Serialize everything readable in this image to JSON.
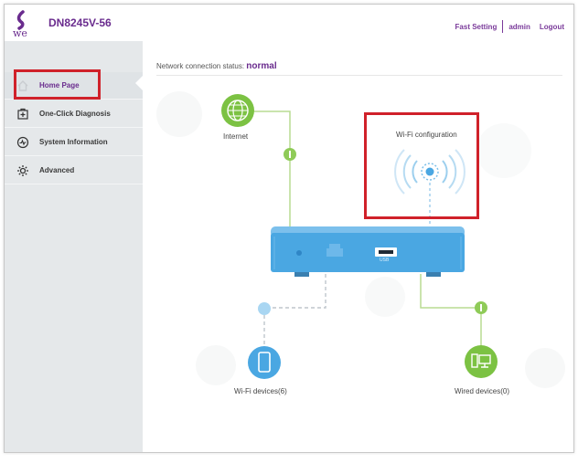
{
  "header": {
    "model": "DN8245V-56",
    "logo_text": "we",
    "links": [
      "Fast Setting",
      "admin",
      "Logout"
    ]
  },
  "sidebar": {
    "items": [
      {
        "label": "Home Page",
        "icon": "home-icon",
        "active": true
      },
      {
        "label": "One-Click Diagnosis",
        "icon": "diagnosis-icon"
      },
      {
        "label": "System Information",
        "icon": "pulse-icon"
      },
      {
        "label": "Advanced",
        "icon": "gear-icon"
      }
    ]
  },
  "main": {
    "status_label": "Network connection status:",
    "status_value": "normal",
    "internet_label": "Internet",
    "wifi_label": "Wi-Fi configuration",
    "usb_label": "USB",
    "wifi_devices_label": "Wi-Fi devices(6)",
    "wired_devices_label": "Wired devices(0)"
  },
  "colors": {
    "brand": "#6a2c8e",
    "highlight": "#d0212a",
    "router": "#4aa7e2",
    "wired_green": "#7cc243",
    "wifi_blue": "#4aa7e2"
  }
}
